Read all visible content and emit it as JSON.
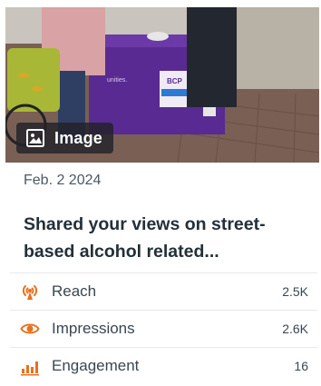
{
  "post": {
    "media_type_label": "Image",
    "media_icon": "image-icon",
    "photo_sign_text": "BCP",
    "photo_banner_text": "unities.",
    "date": "Feb. 2 2024",
    "title": "Shared your views on street-based alcohol related..."
  },
  "metrics": [
    {
      "icon": "reach-antenna-icon",
      "label": "Reach",
      "value": "2.5K"
    },
    {
      "icon": "eye-icon",
      "label": "Impressions",
      "value": "2.6K"
    },
    {
      "icon": "bar-chart-icon",
      "label": "Engagement",
      "value": "16"
    }
  ],
  "colors": {
    "accent_orange": "#e8701f",
    "banner_purple": "#5a2a93",
    "text_dark": "#23303a",
    "text_muted": "#4d5862"
  }
}
